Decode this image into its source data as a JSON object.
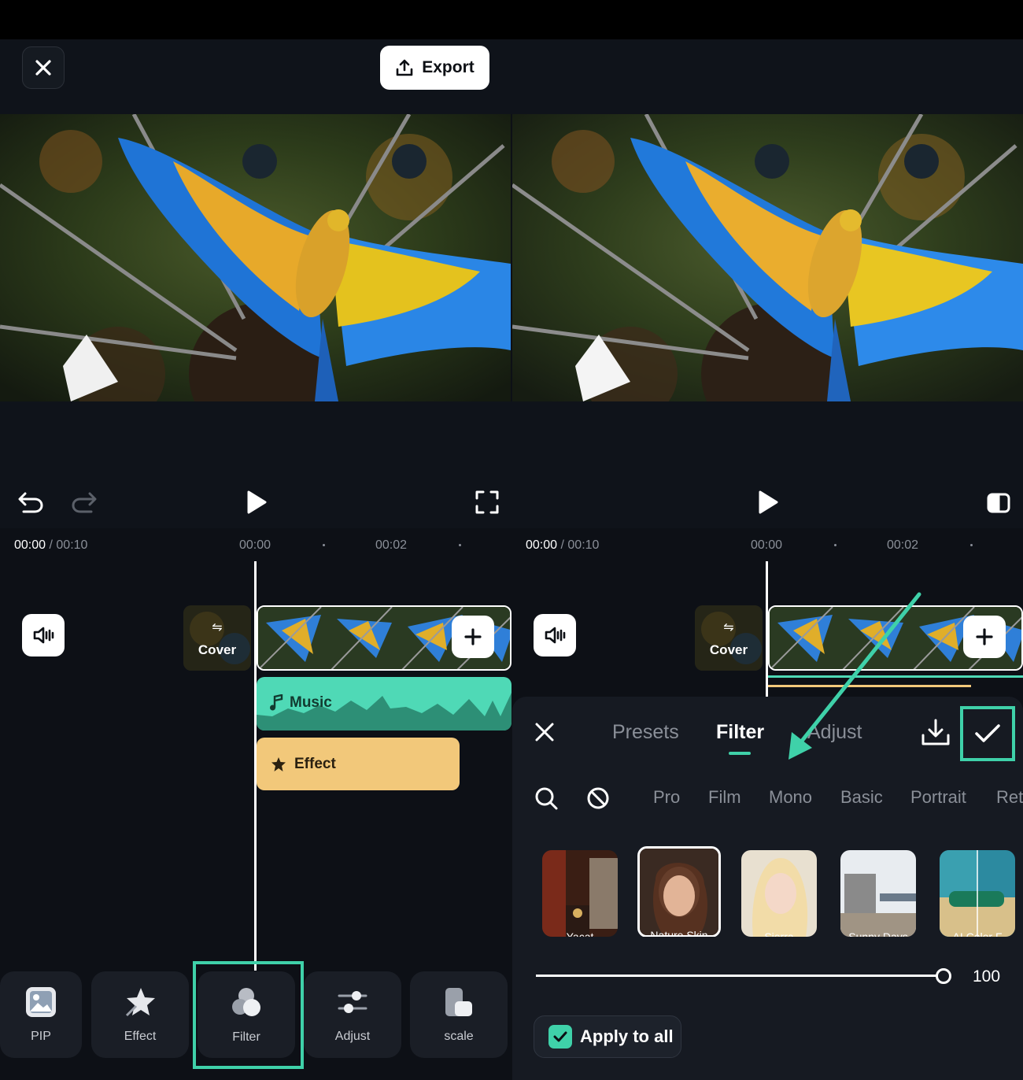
{
  "header": {
    "export_label": "Export"
  },
  "left": {
    "time_current": "00:00",
    "time_total": "/ 00:10",
    "tick1": "00:00",
    "tick2": "00:02",
    "cover_label": "Cover",
    "music_label": "Music",
    "effect_label": "Effect",
    "toolbar": [
      {
        "label": "PIP",
        "icon": "pip-icon"
      },
      {
        "label": "Effect",
        "icon": "effect-icon"
      },
      {
        "label": "Filter",
        "icon": "filter-icon"
      },
      {
        "label": "Adjust",
        "icon": "adjust-icon"
      },
      {
        "label": "scale",
        "icon": "scale-icon"
      }
    ]
  },
  "right": {
    "time_current": "00:00",
    "time_total": "/ 00:10",
    "tick1": "00:00",
    "tick2": "00:02",
    "cover_label": "Cover",
    "panel": {
      "tabs": [
        "Presets",
        "Filter",
        "Adjust"
      ],
      "active_tab": "Filter",
      "categories": [
        "Pro",
        "Film",
        "Mono",
        "Basic",
        "Portrait",
        "Ret"
      ],
      "filters": [
        "Yacat",
        "Nature Skin",
        "Sierra",
        "Sunny Days",
        "AI Color F"
      ],
      "selected_filter": "Nature Skin",
      "intensity": 100,
      "intensity_label": "100",
      "apply_to_all_label": "Apply to all",
      "apply_to_all_checked": true
    }
  },
  "colors": {
    "accent": "#3fd1a9",
    "music": "#4fd9b6",
    "effect": "#f2c87a",
    "bg": "#0d1016"
  }
}
